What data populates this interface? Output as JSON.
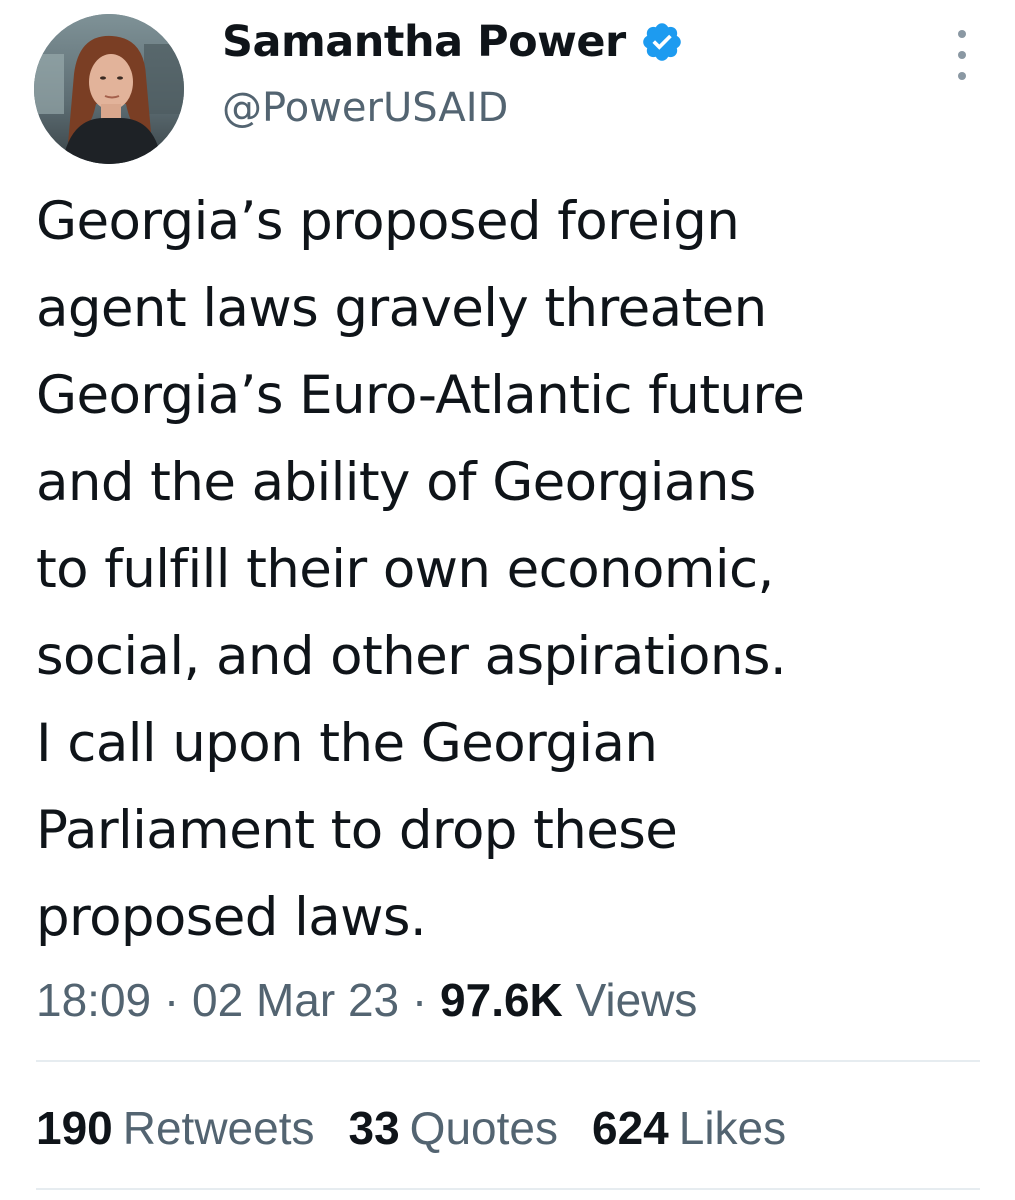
{
  "author": {
    "display_name": "Samantha Power",
    "handle": "@PowerUSAID",
    "verified": true,
    "verified_color": "#1d9bf0"
  },
  "tweet": {
    "text": "Georgia’s proposed foreign\nagent laws gravely threaten\nGeorgia’s Euro-Atlantic future\nand the ability of Georgians\nto fulfill their own economic,\nsocial, and other aspirations.\nI call upon the Georgian\nParliament to drop these\nproposed laws."
  },
  "meta": {
    "time": "18:09",
    "separator": "·",
    "date": "02 Mar 23",
    "views_count": "97.6K",
    "views_label": "Views"
  },
  "stats": {
    "retweets_count": "190",
    "retweets_label": "Retweets",
    "quotes_count": "33",
    "quotes_label": "Quotes",
    "likes_count": "624",
    "likes_label": "Likes"
  },
  "icons": {
    "verified": "verified-badge-icon",
    "more": "more-options-icon"
  },
  "colors": {
    "text_primary": "#0f1419",
    "text_secondary": "#536471",
    "divider": "#e6ecf0"
  }
}
